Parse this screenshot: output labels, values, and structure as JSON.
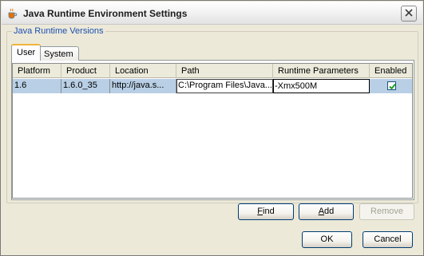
{
  "window": {
    "title": "Java Runtime Environment Settings",
    "icon": "java-coffee-cup-icon",
    "close_icon": "close-icon"
  },
  "group": {
    "legend": "Java Runtime Versions"
  },
  "tabs": [
    {
      "label": "User",
      "selected": true
    },
    {
      "label": "System",
      "selected": false
    }
  ],
  "table": {
    "columns": [
      "Platform",
      "Product",
      "Location",
      "Path",
      "Runtime Parameters",
      "Enabled"
    ],
    "rows": [
      {
        "platform": "1.6",
        "product": "1.6.0_35",
        "location": "http://java.s...",
        "path": "C:\\Program Files\\Java...",
        "runtime_parameters": "-Xmx500M",
        "enabled": true
      }
    ]
  },
  "buttons": {
    "find_prefix": "",
    "find_mnemonic": "F",
    "find_rest": "ind",
    "add_prefix": "",
    "add_mnemonic": "A",
    "add_rest": "dd",
    "remove": "Remove",
    "ok": "OK",
    "cancel": "Cancel"
  },
  "colors": {
    "accent_tab": "#f2b33d",
    "legend": "#1c4fb2",
    "selected_row": "#b8cfe5",
    "checkbox_check": "#21a121"
  }
}
